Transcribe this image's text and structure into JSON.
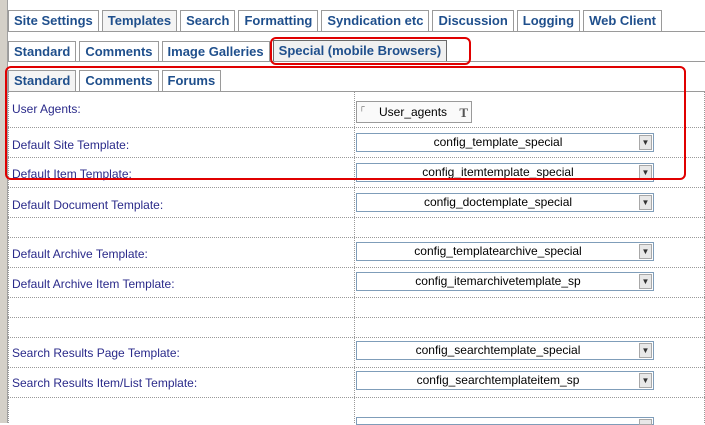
{
  "tabs_level1": [
    "Site Settings",
    "Templates",
    "Search",
    "Formatting",
    "Syndication etc",
    "Discussion",
    "Logging",
    "Web Client"
  ],
  "tabs_level2": [
    "Standard",
    "Comments",
    "Image Galleries",
    "Special (mobile Browsers)"
  ],
  "tabs_level3": [
    "Standard",
    "Comments",
    "Forums"
  ],
  "user_agents": {
    "label": "User Agents:",
    "button_label": "User_agents",
    "corner_icon": "corner-glyph",
    "text_icon": "T"
  },
  "fields": [
    {
      "label": "Default Site Template:",
      "value": "config_template_special"
    },
    {
      "label": "Default Item Template:",
      "value": "config_itemtemplate_special"
    },
    {
      "label": "Default Document Template:",
      "value": "config_doctemplate_special"
    },
    {
      "label": "Default Archive Template:",
      "value": "config_templatearchive_special"
    },
    {
      "label": "Default Archive Item Template:",
      "value": "config_itemarchivetemplate_sp"
    },
    {
      "label": "Search Results Page Template:",
      "value": "config_searchtemplate_special"
    },
    {
      "label": "Search Results Item/List Template:",
      "value": "config_searchtemplateitem_sp"
    }
  ],
  "dropdown_icon": "chevron-down-icon",
  "highlight_color": "#e00000"
}
